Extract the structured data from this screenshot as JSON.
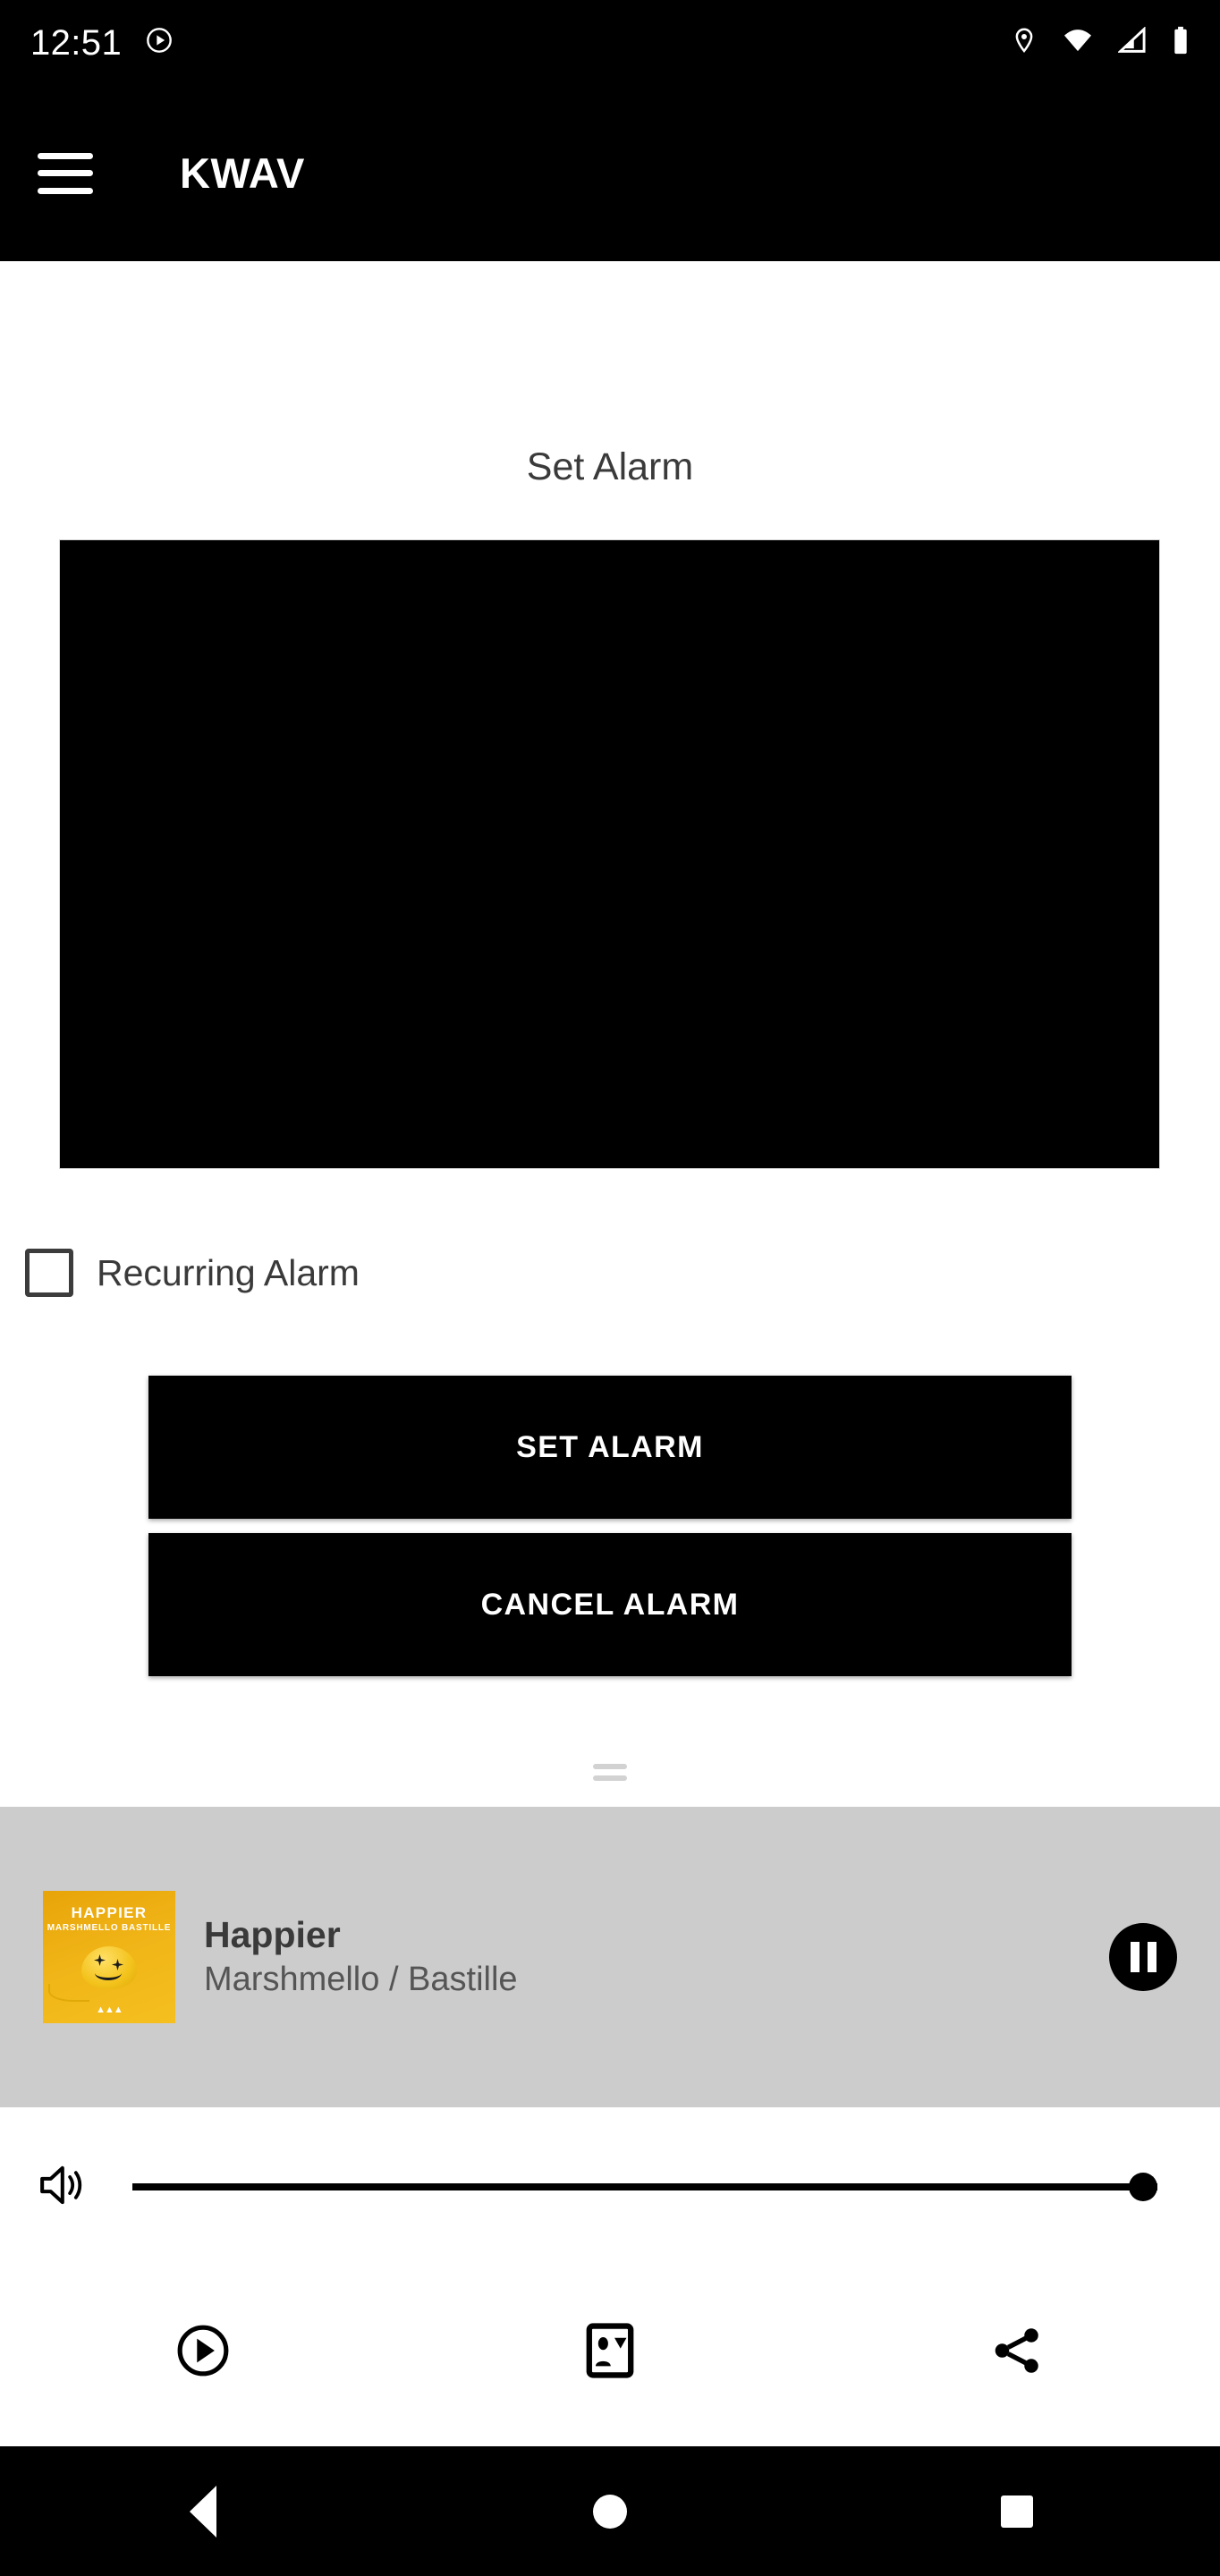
{
  "status_bar": {
    "time": "12:51",
    "left_icons": [
      "play-circle-icon"
    ],
    "right_icons": [
      "location-pin-icon",
      "wifi-icon",
      "cellular-signal-icon",
      "battery-icon"
    ]
  },
  "app_bar": {
    "menu_icon": "hamburger-menu-icon",
    "title": "KWAV"
  },
  "main": {
    "page_title": "Set Alarm",
    "video_placeholder": "",
    "recurring": {
      "label": "Recurring Alarm",
      "checked": false
    },
    "buttons": {
      "set_alarm": "SET ALARM",
      "cancel_alarm": "CANCEL ALARM"
    },
    "drag_handle": "drag-handle"
  },
  "player": {
    "track_title": "Happier",
    "track_artist": "Marshmello / Bastille",
    "album_art": {
      "title": "HAPPIER",
      "artists": "MARSHMELLO  BASTILLE",
      "logo": "▲▲▲",
      "background_color": "#f0b417"
    },
    "play_state_icon": "pause-icon",
    "background_color": "#cccccc"
  },
  "volume": {
    "icon": "volume-up-icon",
    "level": 100
  },
  "actions": [
    {
      "name": "play-circle-icon",
      "label": "Play"
    },
    {
      "name": "contact-card-icon",
      "label": "Contact"
    },
    {
      "name": "share-icon",
      "label": "Share"
    }
  ],
  "nav_bar": {
    "back": "back-triangle-icon",
    "home": "home-circle-icon",
    "recents": "recents-square-icon"
  }
}
